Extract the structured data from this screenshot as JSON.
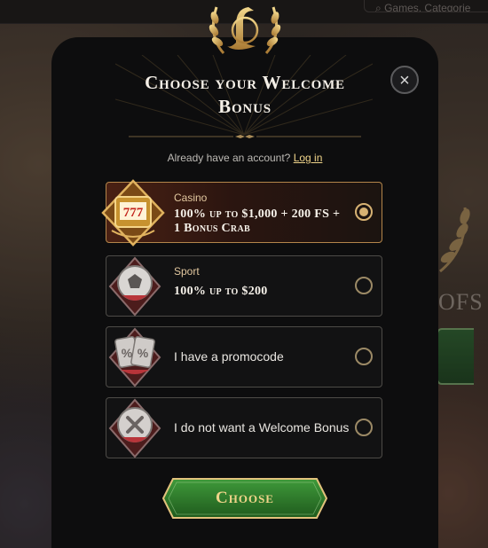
{
  "background": {
    "search_text": "Games, Categorie",
    "promo_fragment": "OFS"
  },
  "modal": {
    "title_line1": "Choose your Welcome",
    "title_line2": "Bonus",
    "login_prompt": "Already have an account?",
    "login_link": "Log in",
    "close_icon": "×",
    "options": [
      {
        "category": "Casino",
        "offer_line1": "100% up to $1,000 + 200 FS +",
        "offer_line2": "1 Bonus Crab",
        "icon": "slot-777-icon",
        "selected": true
      },
      {
        "category": "Sport",
        "offer_line1": "100% up to $200",
        "icon": "soccer-ball-icon",
        "selected": false
      },
      {
        "label": "I have a promocode",
        "icon": "percent-cards-icon",
        "selected": false
      },
      {
        "label": "I do not want a Welcome Bonus",
        "icon": "cross-circle-icon",
        "selected": false
      }
    ],
    "choose_button": "Choose"
  },
  "colors": {
    "accent_gold": "#d7b273",
    "selected_bg": "#4a2113",
    "button_green": "#2e7a2c"
  }
}
